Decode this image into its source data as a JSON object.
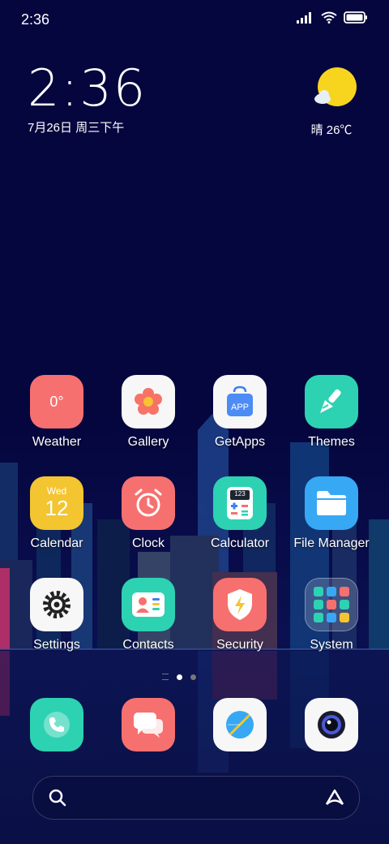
{
  "status_bar": {
    "time": "2:36"
  },
  "clock_widget": {
    "time": "2:36",
    "date": "7月26日 周三下午"
  },
  "weather_widget": {
    "temperature": "晴 26℃",
    "icon": "sun-cloud-icon"
  },
  "apps": [
    {
      "label": "Weather",
      "icon": "weather-icon",
      "color": "#f6706f",
      "text": "0°"
    },
    {
      "label": "Gallery",
      "icon": "flower-icon",
      "color": "#f7f7f7"
    },
    {
      "label": "GetApps",
      "icon": "shopping-bag-icon",
      "color": "#f7f7f7",
      "text": "APP"
    },
    {
      "label": "Themes",
      "icon": "paintbrush-icon",
      "color": "#2dd2b2"
    },
    {
      "label": "Calendar",
      "icon": "calendar-icon",
      "color": "#f3c531",
      "day": "Wed",
      "date": "12"
    },
    {
      "label": "Clock",
      "icon": "alarm-clock-icon",
      "color": "#f6706f"
    },
    {
      "label": "Calculator",
      "icon": "calculator-icon",
      "color": "#2dd2b2",
      "text": "123"
    },
    {
      "label": "File Manager",
      "icon": "folder-icon",
      "color": "#37a8f4"
    },
    {
      "label": "Settings",
      "icon": "gear-icon",
      "color": "#f7f7f7"
    },
    {
      "label": "Contacts",
      "icon": "contact-card-icon",
      "color": "#2dd2b2"
    },
    {
      "label": "Security",
      "icon": "shield-icon",
      "color": "#f6706f"
    },
    {
      "label": "System",
      "icon": "folder-grid-icon",
      "color": "#ffffff"
    }
  ],
  "dock": [
    {
      "icon": "phone-icon",
      "color": "#2dd2b2"
    },
    {
      "icon": "message-icon",
      "color": "#f6706f"
    },
    {
      "icon": "browser-compass-icon",
      "color": "#f7f7f7"
    },
    {
      "icon": "camera-icon",
      "color": "#f7f7f7"
    }
  ],
  "page_indicator": {
    "pages": 2,
    "current": 1
  },
  "search_bar": {
    "left_icon": "search-icon",
    "right_icon": "assistant-icon"
  }
}
